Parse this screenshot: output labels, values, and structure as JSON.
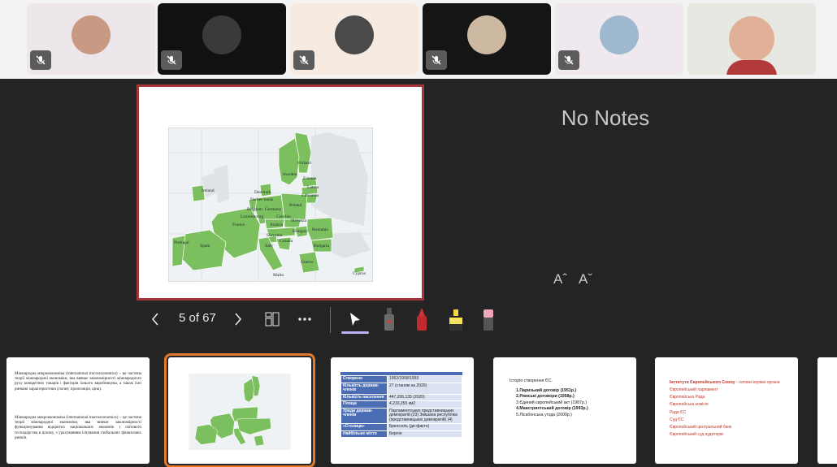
{
  "participants": [
    {
      "bg": "#ede7ec",
      "face": "#c89a84",
      "muted": true
    },
    {
      "bg": "#111111",
      "face": "#3a3a3a",
      "muted": true
    },
    {
      "bg": "#f6eae1",
      "face": "#4a4a4a",
      "muted": true
    },
    {
      "bg": "#151515",
      "face": "#cdb9a2",
      "muted": true
    },
    {
      "bg": "#efe8ee",
      "face": "#9db8cf",
      "muted": true
    },
    {
      "bg": "#e8e8e2",
      "face": "#e0b098",
      "muted": false
    }
  ],
  "map_labels": [
    "Finland",
    "Sweden",
    "Estonia",
    "Latvia",
    "Lithuania",
    "Ireland",
    "Denmark",
    "Nether-lands",
    "Belgium",
    "Germany",
    "Poland",
    "Luxembourg",
    "Czechia",
    "Slovakia",
    "France",
    "Austria",
    "Hungary",
    "Slovenia",
    "Croatia",
    "Romania",
    "Portugal",
    "Spain",
    "Italy",
    "Bulgaria",
    "Greece",
    "Malta",
    "Cyprus"
  ],
  "notes": {
    "text": "No Notes"
  },
  "font_controls": {
    "increase": "Aˆ",
    "decrease": "Aˇ"
  },
  "toolbar": {
    "page": "5 of 67"
  },
  "colors": {
    "accent": "#a4373a",
    "selection": "#e07a2e",
    "map_eu": "#7cbf5e",
    "map_other": "#dde3e6"
  },
  "thumbs": {
    "slide1": {
      "p1": "Міжнародна мікроекономіка (international microeconomics) – це частина теорії міжнародної економіки, яка вивчає закономірності міжнародного руху конкретних товарів і факторів їхнього виробництва, а також їхні ринкові характеристики (попит, пропозиція, ціна).",
      "p2": "Міжнародна макроекономіка (international macroeconomics) – це частина теорії міжнародної економіки, яка вивчає закономірності функціонування відкритих національних економік і світового господарства в цілому, з урахуванням існування глобальних фінансових ринків."
    },
    "slide3": {
      "rows": [
        {
          "k": "Створено",
          "v": "1952/1958/1993"
        },
        {
          "k": "Кількість держав-членів",
          "v": "27 (станом на 2020)"
        },
        {
          "k": "Кількість населення",
          "v": "447,206,135 (2020)"
        },
        {
          "k": "Площа",
          "v": "4,233,255 км2"
        },
        {
          "k": "Уряди держав-членів",
          "v": "Парламентських представницьких демократій (23) Змішана республіка (представницьких демократій) (4)"
        },
        {
          "k": "«Столиця»",
          "v": "Брюссель (де-факто)"
        },
        {
          "k": "Найбільше місто",
          "v": "Берлін"
        }
      ]
    },
    "slide4": {
      "title": "Історія створення ЄС.",
      "items": [
        "1.Паризький договір (1951р.)",
        "2.Римські договори (1958р.)",
        "3.Єдиний європейський акт (1987р.)",
        "4.Маастрихтський договір (1993р.)",
        "5.Лісабонська угода (2009р.)"
      ]
    },
    "slide5": {
      "title": "Інститути Європейського Союзу",
      "subtitle": " - головні керівні органи",
      "items": [
        "Європейський парламент",
        "Європейська Рада",
        "Європейська комісія",
        "Рада ЄС",
        "Суд ЄС",
        "Європейський центральний банк",
        "Європейський суд аудиторів"
      ]
    }
  }
}
